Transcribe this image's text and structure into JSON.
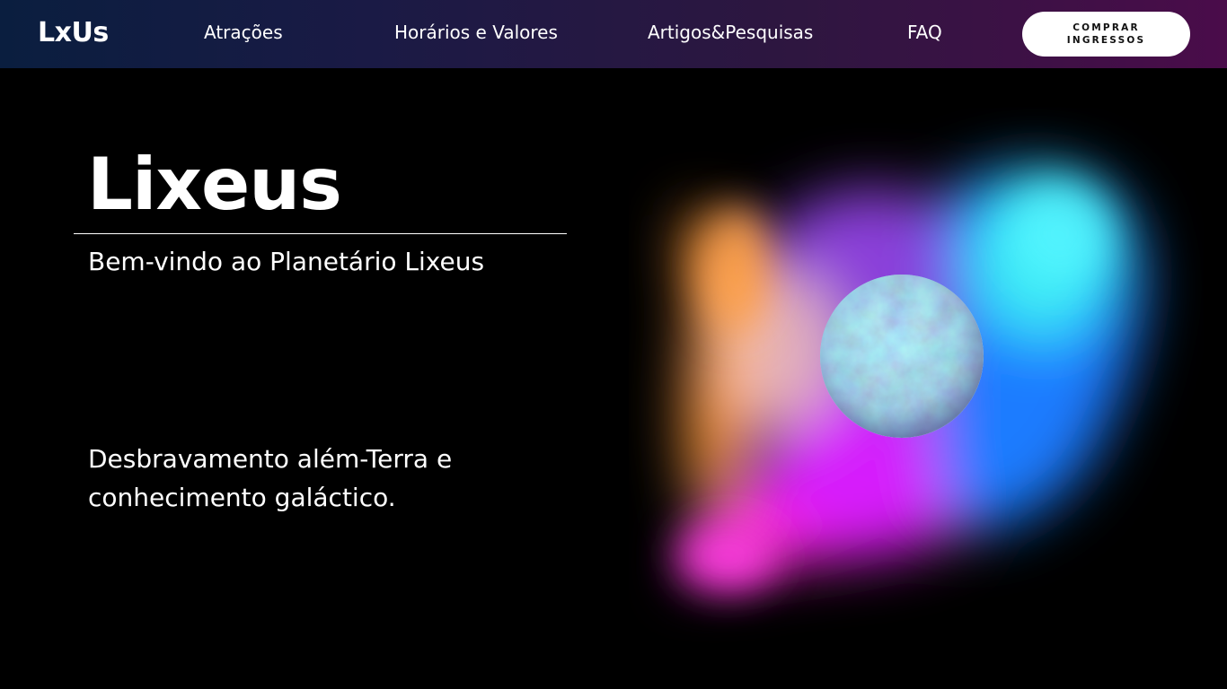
{
  "header": {
    "logo": "LxUs",
    "nav": [
      {
        "label": "Atrações"
      },
      {
        "label": "Horários e Valores"
      },
      {
        "label": "Artigos&Pesquisas"
      },
      {
        "label": "FAQ"
      }
    ],
    "cta_label": "COMPRAR INGRESSOS"
  },
  "hero": {
    "title": "Lixeus",
    "subtitle": "Bem-vindo ao Planetário Lixeus",
    "tagline": "Desbravamento além-Terra e conhecimento galáctico."
  },
  "colors": {
    "background": "#000000",
    "nav_gradient_start": "#0a1e3f",
    "nav_gradient_end": "#4a0c4a",
    "text": "#ffffff",
    "cta_background": "#ffffff",
    "glow_orange": "#ff9a3c",
    "glow_magenta": "#ff2ad9",
    "glow_purple": "#b04bff",
    "glow_blue": "#1a8cff",
    "glow_cyan": "#3ef0f5",
    "planet": "#7fa8c8"
  },
  "art": {
    "icon": "nebula-planet-illustration"
  }
}
